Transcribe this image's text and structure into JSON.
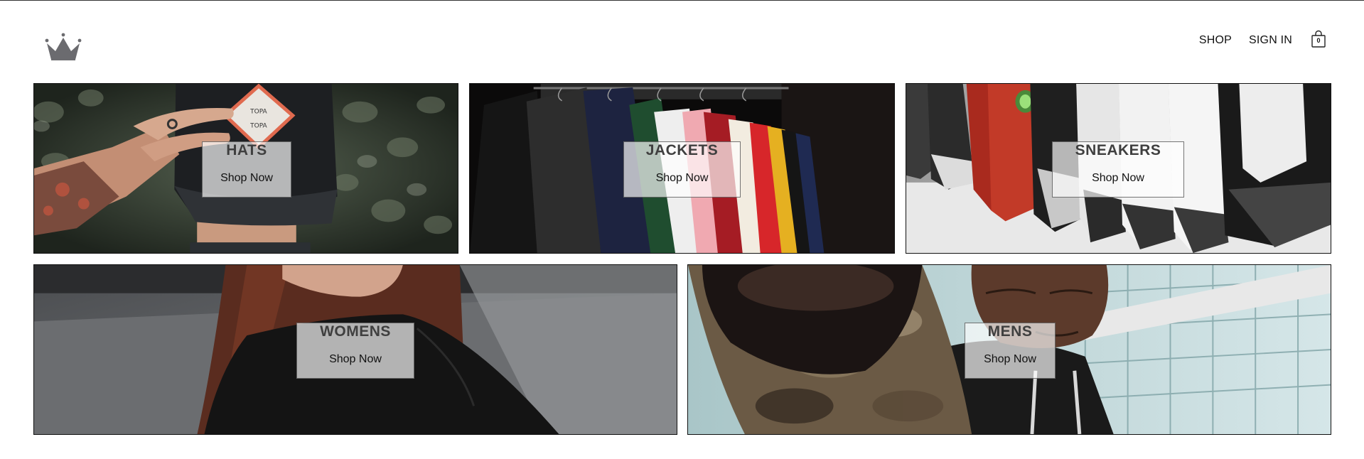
{
  "header": {
    "logo_icon": "crown-icon",
    "nav": {
      "shop_label": "SHOP",
      "signin_label": "SIGN IN"
    },
    "cart": {
      "icon": "shopping-bag-icon",
      "count": "0"
    }
  },
  "categories": [
    {
      "title": "HATS",
      "cta": "Shop Now"
    },
    {
      "title": "JACKETS",
      "cta": "Shop Now"
    },
    {
      "title": "SNEAKERS",
      "cta": "Shop Now"
    },
    {
      "title": "WOMENS",
      "cta": "Shop Now"
    },
    {
      "title": "MENS",
      "cta": "Shop Now"
    }
  ]
}
